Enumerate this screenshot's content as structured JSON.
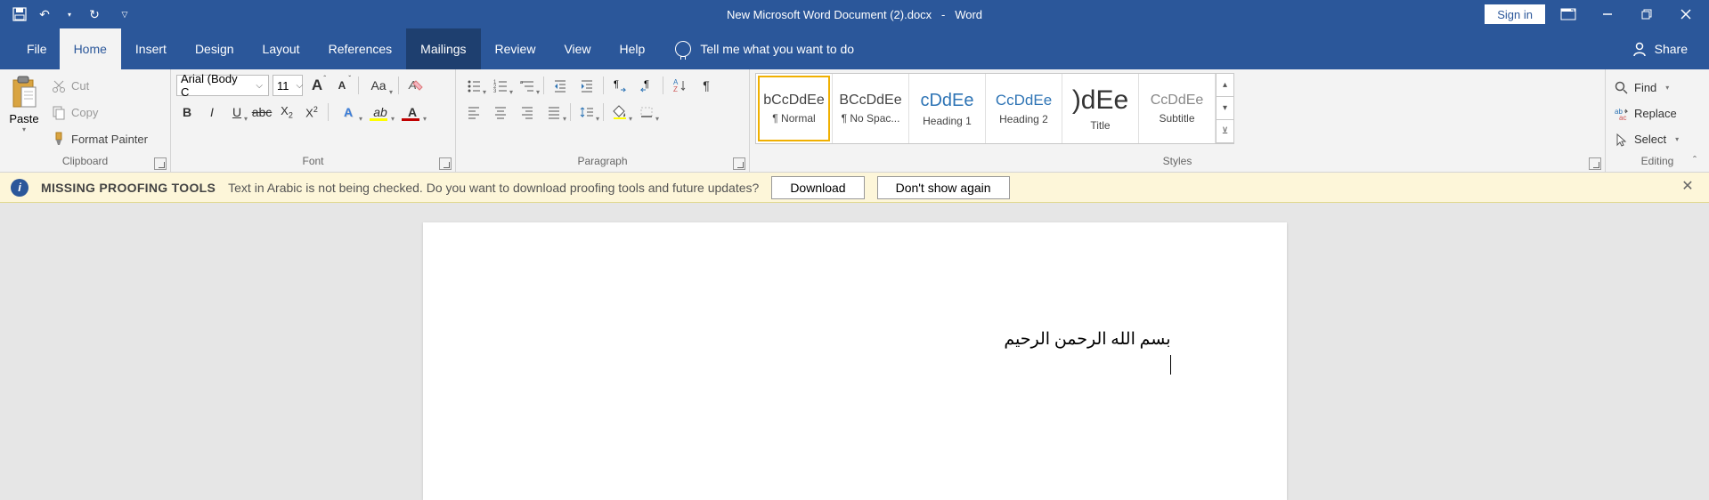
{
  "title": {
    "doc": "New Microsoft Word Document (2).docx",
    "app": "Word",
    "signin": "Sign in"
  },
  "tabs": {
    "file": "File",
    "home": "Home",
    "insert": "Insert",
    "design": "Design",
    "layout": "Layout",
    "references": "References",
    "mailings": "Mailings",
    "review": "Review",
    "view": "View",
    "help": "Help",
    "tellme": "Tell me what you want to do",
    "share": "Share"
  },
  "clipboard": {
    "paste": "Paste",
    "cut": "Cut",
    "copy": "Copy",
    "format_painter": "Format Painter",
    "label": "Clipboard"
  },
  "font": {
    "name": "Arial (Body C",
    "size": "11",
    "label": "Font"
  },
  "paragraph": {
    "label": "Paragraph"
  },
  "styles": {
    "label": "Styles",
    "items": [
      {
        "name": "¶ Normal",
        "preview": "bCcDdEe",
        "cls": ""
      },
      {
        "name": "¶ No Spac...",
        "preview": "BCcDdEe",
        "cls": ""
      },
      {
        "name": "Heading 1",
        "preview": "cDdEe",
        "cls": "color:#2e74b5;font-size:20px"
      },
      {
        "name": "Heading 2",
        "preview": "CcDdEe",
        "cls": "color:#2e74b5;font-size:17px"
      },
      {
        "name": "Title",
        "preview": ")dEe",
        "cls": "font-size:30px;color:#333"
      },
      {
        "name": "Subtitle",
        "preview": "CcDdEe",
        "cls": "color:#888"
      }
    ]
  },
  "editing": {
    "find": "Find",
    "replace": "Replace",
    "select": "Select",
    "label": "Editing"
  },
  "msgbar": {
    "title": "MISSING PROOFING TOOLS",
    "text": "Text in Arabic is not being checked. Do you want to download proofing tools and future updates?",
    "download": "Download",
    "dontshow": "Don't show again"
  },
  "document": {
    "line1": "بسم الله الرحمن الرحيم"
  }
}
